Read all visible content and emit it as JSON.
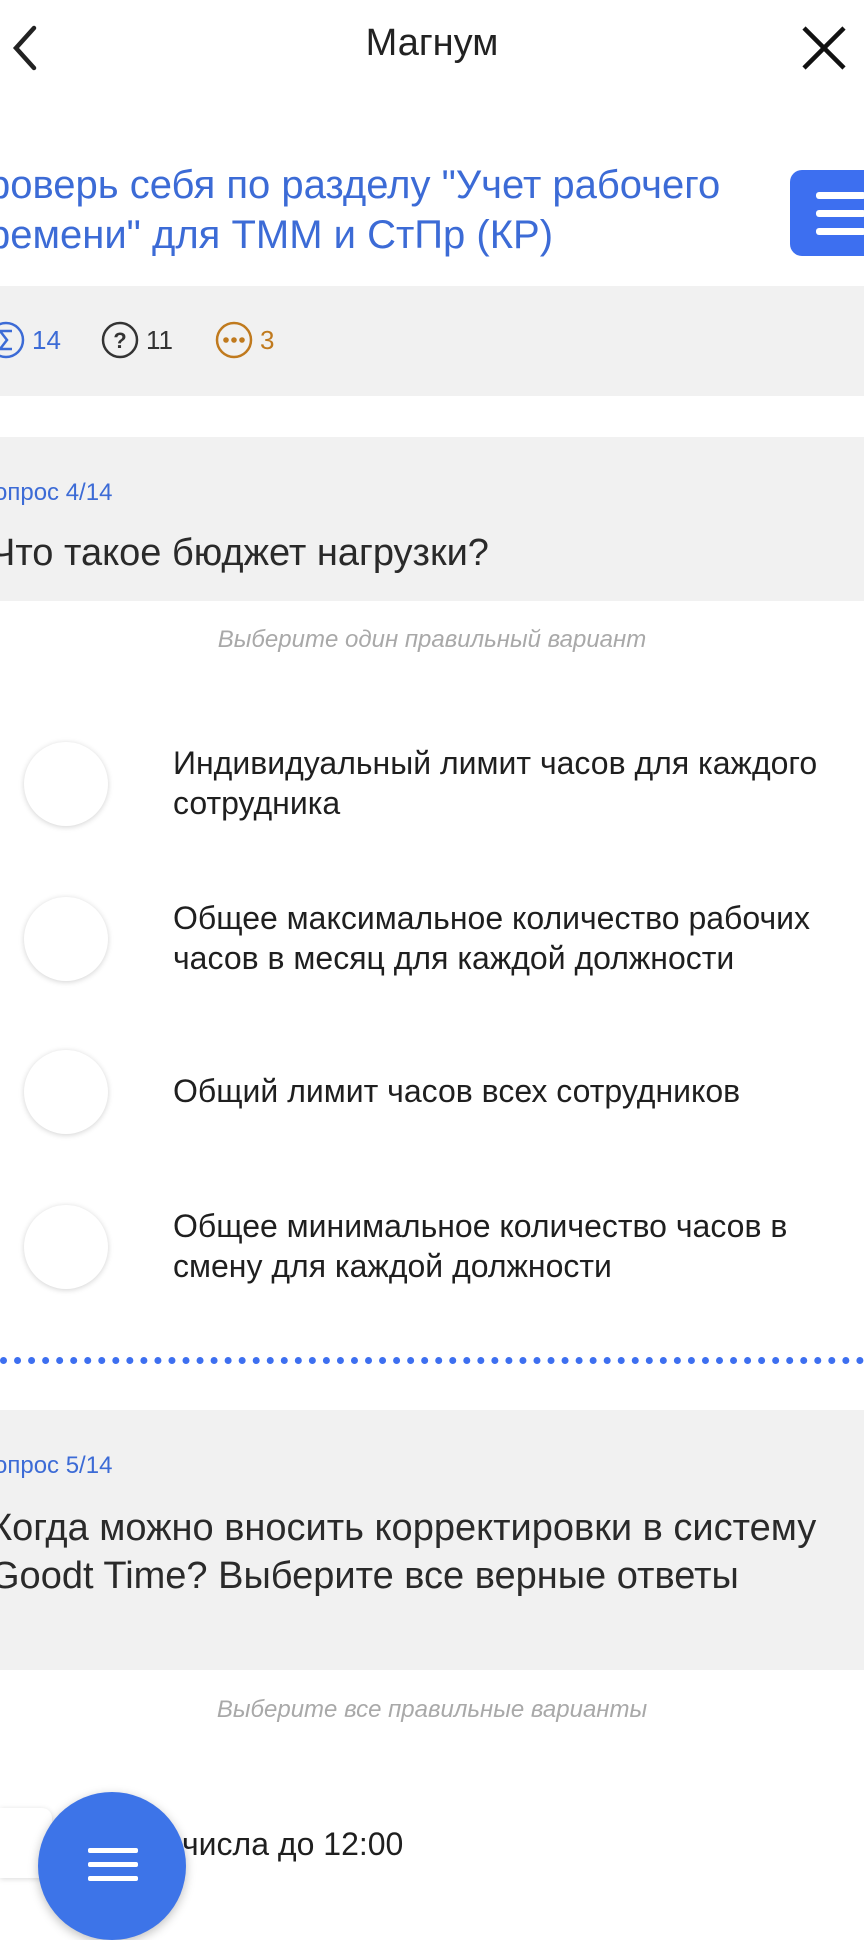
{
  "header": {
    "title": "Магнум",
    "back_icon": "chevron-left-icon",
    "close_icon": "close-icon"
  },
  "test": {
    "title_line1": "роверь себя по разделу \"Учет рабочего",
    "title_line2": "ремени\" для ТММ и СтПр (КР)",
    "menu_icon": "hamburger-icon"
  },
  "stats": {
    "total": "14",
    "unanswered": "11",
    "in_progress": "3",
    "colors": {
      "total": "#3c6bd6",
      "unanswered": "#333333",
      "in_progress": "#c07a1e"
    }
  },
  "questions": [
    {
      "number": "опрос 4/14",
      "text": "Что такое бюджет нагрузки?",
      "hint": "Выберите один правильный вариант",
      "options": [
        "Индивидуальный лимит часов для каждого сотрудника",
        "Общее максимальное количество рабочих часов в месяц для каждой должности",
        "Общий лимит часов всех сотрудников",
        "Общее минимальное количество часов в смену для каждой должности"
      ]
    },
    {
      "number": "опрос 5/14",
      "text": "Когда можно вносить корректировки в систему Goodt Time? Выберите все верные ответы",
      "hint": "Выберите все правильные варианты",
      "options": [
        "числа до 12:00"
      ]
    }
  ],
  "fab_icon": "menu-icon",
  "accent_color": "#3d6ff0"
}
